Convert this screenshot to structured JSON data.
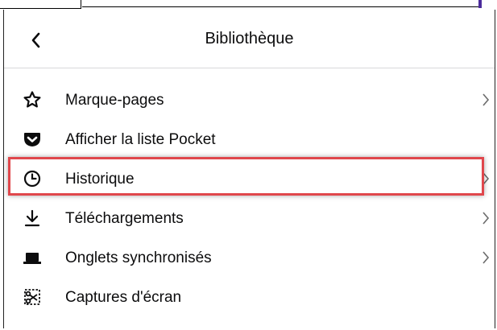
{
  "header": {
    "back_icon": "chevron-left-icon",
    "title": "Bibliothèque"
  },
  "menu": {
    "items": [
      {
        "label": "Marque-pages",
        "icon": "star-icon",
        "has_submenu": true
      },
      {
        "label": "Afficher la liste Pocket",
        "icon": "pocket-icon",
        "has_submenu": false
      },
      {
        "label": "Historique",
        "icon": "clock-icon",
        "has_submenu": true,
        "highlighted": true
      },
      {
        "label": "Téléchargements",
        "icon": "download-icon",
        "has_submenu": true
      },
      {
        "label": "Onglets synchronisés",
        "icon": "synced-tabs-icon",
        "has_submenu": true
      },
      {
        "label": "Captures d'écran",
        "icon": "screenshot-icon",
        "has_submenu": false
      }
    ]
  },
  "colors": {
    "highlight_border": "#e0474c",
    "text": "#0c0c0d",
    "divider": "#d7d7db"
  }
}
